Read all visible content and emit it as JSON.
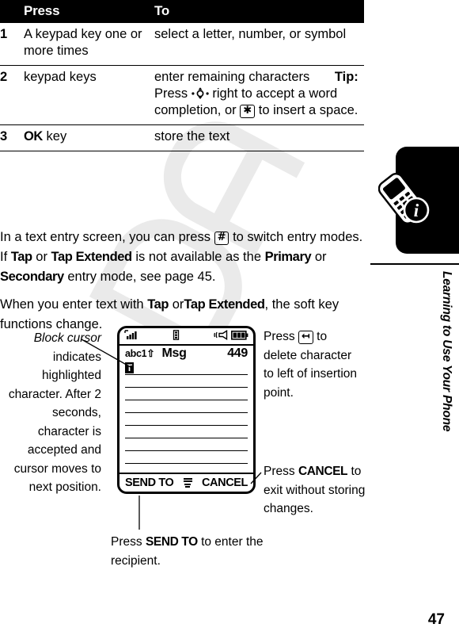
{
  "table": {
    "headers": {
      "num": "",
      "press": "Press",
      "to": "To"
    },
    "rows": [
      {
        "num": "1",
        "press": "A keypad key one or more times",
        "to": "select a letter, number, or symbol",
        "tip": null
      },
      {
        "num": "2",
        "press": "keypad keys",
        "to": "enter remaining characters",
        "tip": {
          "label": "Tip:",
          "part1": "Press",
          "icon": "navigation-key-icon",
          "part2": "right to accept a word completion, or",
          "icon2": "asterisk-key-icon",
          "part3": "to insert a space."
        }
      },
      {
        "num": "3",
        "press": "OK key",
        "press_bold": "OK",
        "press_rest": "key",
        "to": "store the text",
        "tip": null
      }
    ]
  },
  "paragraphs": {
    "p1_a": "In a text entry screen, you can press",
    "p1_icon": "pound-key-icon",
    "p1_b": "to switch entry modes. If",
    "p1_bold1": "Tap",
    "p1_c": "or",
    "p1_bold2": "Tap Extended",
    "p1_d": "is not available as the",
    "p1_bold3": "Primary",
    "p1_e": "or",
    "p1_bold4": "Secondary",
    "p1_f": "entry mode, see page 45.",
    "p2_a": "When you enter text with",
    "p2_bold1": "Tap",
    "p2_b": "or",
    "p2_bold2": "Tap Extended",
    "p2_c": ", the soft key functions change."
  },
  "phone_screen": {
    "status_icons": [
      "signal-strength-icon",
      "message-icon",
      "ringer-alert-icon",
      "battery-icon"
    ],
    "entry_mode": "abc1",
    "entry_mode_arrow": "shift-up-icon",
    "title": "Msg",
    "char_count": "449",
    "cursor_char": "T",
    "text_line_count": 8,
    "softkey_left": "SEND TO",
    "softkey_center_icon": "menu-icon",
    "softkey_right": "CANCEL"
  },
  "annotations": {
    "left": {
      "italic": "Block cursor",
      "rest": "indicates highlighted character. After 2 seconds, character is accepted and cursor moves to next position."
    },
    "right_top": {
      "a": "Press",
      "icon": "delete-key-icon",
      "b": "to delete character to left of insertion point."
    },
    "right_bottom": {
      "a": "Press",
      "bold": "CANCEL",
      "b": "to exit without storing changes."
    },
    "bottom": {
      "a": "Press",
      "bold": "SEND TO",
      "b": "to enter the recipient."
    }
  },
  "sidebar": {
    "chapter_title": "Learning to Use Your Phone",
    "icon": "phone-info-icon",
    "page_number": "47"
  },
  "watermark": {
    "text": "DRAFT",
    "color": "#b9b9b9"
  }
}
